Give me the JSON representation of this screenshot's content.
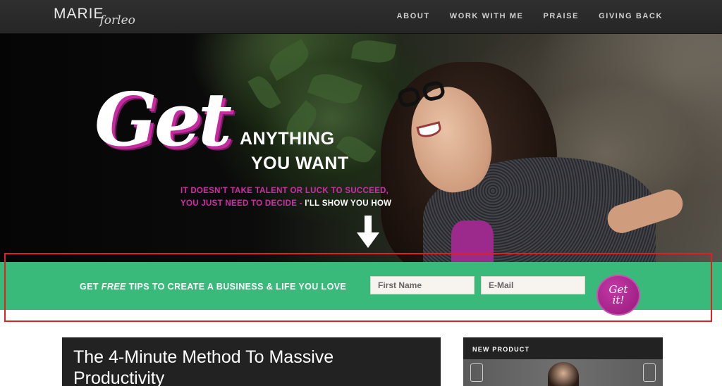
{
  "brand": {
    "name_main": "MARIE",
    "name_script": "forleo"
  },
  "nav": {
    "items": [
      {
        "label": "ABOUT"
      },
      {
        "label": "WORK WITH ME"
      },
      {
        "label": "PRAISE"
      },
      {
        "label": "GIVING BACK"
      }
    ]
  },
  "hero": {
    "script_word": "Get",
    "headline_line1": "ANYTHING",
    "headline_line2": "YOU WANT",
    "sub_line1": "IT DOESN'T TAKE TALENT OR LUCK TO SUCCEED,",
    "sub_line2_pink": "YOU JUST NEED TO DECIDE -",
    "sub_line2_white": " I'LL SHOW YOU HOW",
    "arrow_icon": "down-arrow-icon"
  },
  "optin": {
    "text_before": "GET ",
    "text_emphasis": "FREE",
    "text_after": " TIPS TO CREATE A BUSINESS & LIFE YOU LOVE",
    "first_name_placeholder": "First Name",
    "email_placeholder": "E-Mail",
    "button_line1": "Get",
    "button_line2": "it!"
  },
  "article": {
    "title": "The 4-Minute Method To Massive Productivity"
  },
  "sidebar": {
    "new_product_label": "NEW PRODUCT"
  },
  "colors": {
    "accent_pink": "#d12ca7",
    "optin_green": "#3aba7a",
    "nav_bg": "#2a2a2a",
    "highlight_red": "#e02020"
  }
}
